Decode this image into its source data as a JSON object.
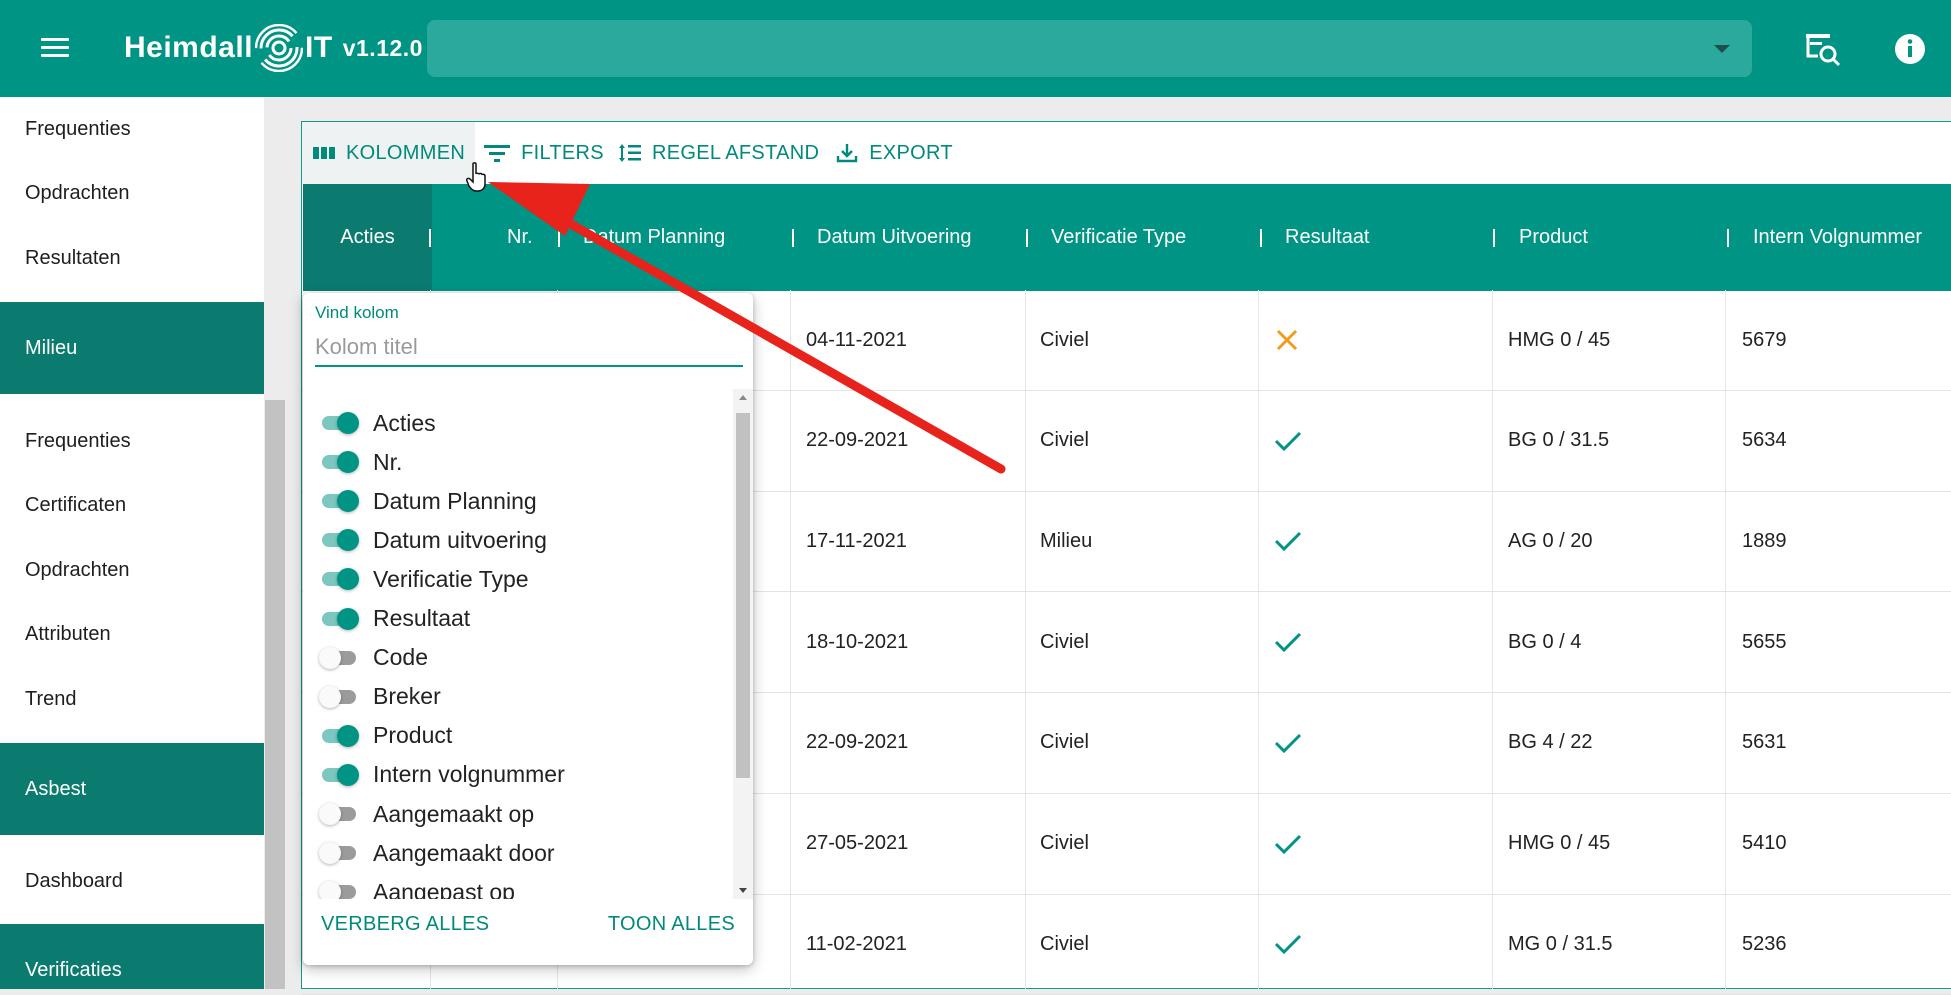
{
  "header": {
    "logo_text_left": "Heimdall",
    "logo_text_right": "IT",
    "version": "v1.12.0"
  },
  "sidebar": {
    "items": [
      {
        "label": "Frequenties",
        "type": "item"
      },
      {
        "label": "Opdrachten",
        "type": "item"
      },
      {
        "label": "Resultaten",
        "type": "item"
      },
      {
        "label": "Milieu",
        "type": "group"
      },
      {
        "label": "Frequenties",
        "type": "item"
      },
      {
        "label": "Certificaten",
        "type": "item"
      },
      {
        "label": "Opdrachten",
        "type": "item"
      },
      {
        "label": "Attributen",
        "type": "item"
      },
      {
        "label": "Trend",
        "type": "item"
      },
      {
        "label": "Asbest",
        "type": "group"
      },
      {
        "label": "Dashboard",
        "type": "item"
      },
      {
        "label": "Verificaties",
        "type": "group"
      }
    ]
  },
  "toolbar": {
    "columns_label": "KOLOMMEN",
    "filters_label": "FILTERS",
    "spacing_label": "REGEL AFSTAND",
    "export_label": "EXPORT"
  },
  "table": {
    "columns": [
      "Acties",
      "Nr.",
      "Datum Planning",
      "Datum Uitvoering",
      "Verificatie Type",
      "Resultaat",
      "Product",
      "Intern Volgnummer"
    ],
    "rows": [
      {
        "uitvoering": "04-11-2021",
        "type": "Civiel",
        "resultaat": "fail",
        "product": "HMG 0 / 45",
        "volgnummer": "5679"
      },
      {
        "uitvoering": "22-09-2021",
        "type": "Civiel",
        "resultaat": "pass",
        "product": "BG 0 / 31.5",
        "volgnummer": "5634"
      },
      {
        "uitvoering": "17-11-2021",
        "type": "Milieu",
        "resultaat": "pass",
        "product": "AG 0 / 20",
        "volgnummer": "1889"
      },
      {
        "uitvoering": "18-10-2021",
        "type": "Civiel",
        "resultaat": "pass",
        "product": "BG 0 / 4",
        "volgnummer": "5655"
      },
      {
        "uitvoering": "22-09-2021",
        "type": "Civiel",
        "resultaat": "pass",
        "product": "BG 4 / 22",
        "volgnummer": "5631"
      },
      {
        "uitvoering": "27-05-2021",
        "type": "Civiel",
        "resultaat": "pass",
        "product": "HMG 0 / 45",
        "volgnummer": "5410"
      },
      {
        "uitvoering": "11-02-2021",
        "type": "Civiel",
        "resultaat": "pass",
        "product": "MG 0 / 31.5",
        "volgnummer": "5236"
      }
    ]
  },
  "column_picker": {
    "find_label": "Vind kolom",
    "find_placeholder": "Kolom titel",
    "columns": [
      {
        "label": "Acties",
        "visible": true
      },
      {
        "label": "Nr.",
        "visible": true
      },
      {
        "label": "Datum Planning",
        "visible": true
      },
      {
        "label": "Datum uitvoering",
        "visible": true
      },
      {
        "label": "Verificatie Type",
        "visible": true
      },
      {
        "label": "Resultaat",
        "visible": true
      },
      {
        "label": "Code",
        "visible": false
      },
      {
        "label": "Breker",
        "visible": false
      },
      {
        "label": "Product",
        "visible": true
      },
      {
        "label": "Intern volgnummer",
        "visible": true
      },
      {
        "label": "Aangemaakt op",
        "visible": false
      },
      {
        "label": "Aangemaakt door",
        "visible": false
      },
      {
        "label": "Aangepast op",
        "visible": false
      }
    ],
    "hide_all_label": "VERBERG ALLES",
    "show_all_label": "TOON ALLES"
  },
  "colors": {
    "primary": "#009485",
    "primary_dark": "#0b7b70",
    "fail": "#f29b1d",
    "pass": "#009485",
    "annotation_arrow": "#e8231c"
  }
}
